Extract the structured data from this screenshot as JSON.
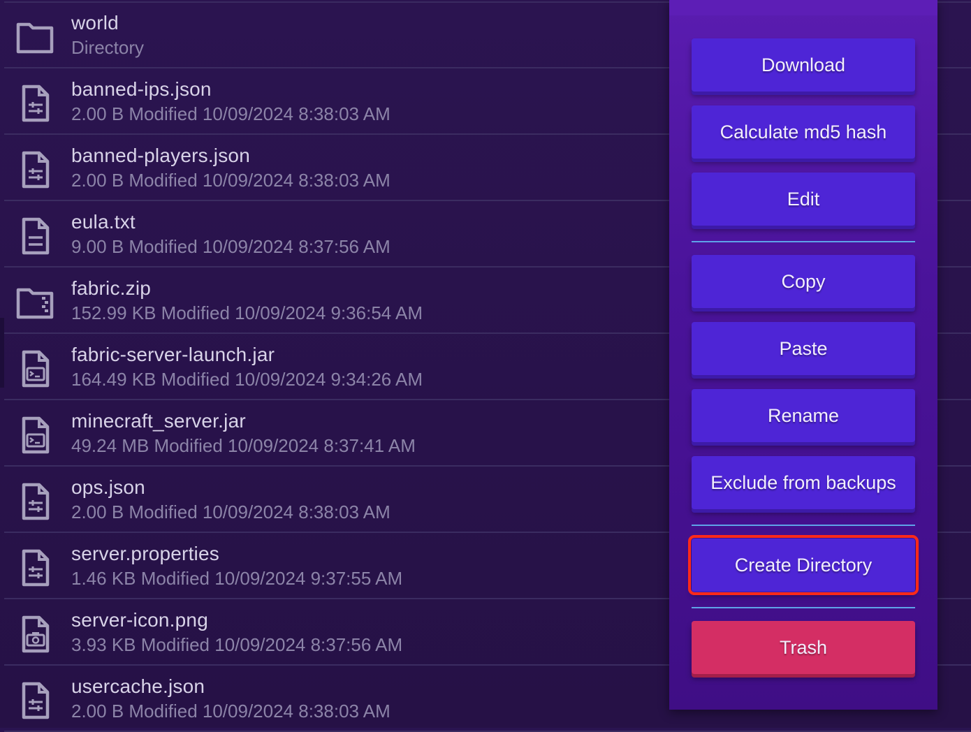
{
  "files": [
    {
      "name": "world",
      "meta": "Directory",
      "icon": "folder-icon"
    },
    {
      "name": "banned-ips.json",
      "meta": "2.00 B Modified 10/09/2024 8:38:03 AM",
      "icon": "settings-file-icon"
    },
    {
      "name": "banned-players.json",
      "meta": "2.00 B Modified 10/09/2024 8:38:03 AM",
      "icon": "settings-file-icon"
    },
    {
      "name": "eula.txt",
      "meta": "9.00 B Modified 10/09/2024 8:37:56 AM",
      "icon": "text-file-icon"
    },
    {
      "name": "fabric.zip",
      "meta": "152.99 KB Modified 10/09/2024 9:36:54 AM",
      "icon": "zip-folder-icon"
    },
    {
      "name": "fabric-server-launch.jar",
      "meta": "164.49 KB Modified 10/09/2024 9:34:26 AM",
      "icon": "terminal-file-icon"
    },
    {
      "name": "minecraft_server.jar",
      "meta": "49.24 MB Modified 10/09/2024 8:37:41 AM",
      "icon": "terminal-file-icon"
    },
    {
      "name": "ops.json",
      "meta": "2.00 B Modified 10/09/2024 8:38:03 AM",
      "icon": "settings-file-icon"
    },
    {
      "name": "server.properties",
      "meta": "1.46 KB Modified 10/09/2024 9:37:55 AM",
      "icon": "settings-file-icon"
    },
    {
      "name": "server-icon.png",
      "meta": "3.93 KB Modified 10/09/2024 8:37:56 AM",
      "icon": "image-file-icon"
    },
    {
      "name": "usercache.json",
      "meta": "2.00 B Modified 10/09/2024 8:38:03 AM",
      "icon": "settings-file-icon"
    }
  ],
  "menu": {
    "download": "Download",
    "md5": "Calculate md5 hash",
    "edit": "Edit",
    "copy": "Copy",
    "paste": "Paste",
    "rename": "Rename",
    "exclude": "Exclude from backups",
    "create_directory": "Create Directory",
    "trash": "Trash"
  },
  "colors": {
    "background": "#2a1451",
    "button": "#4e25d6",
    "trash": "#d42e64",
    "separator": "#5fa3e8",
    "highlight": "#ff2a1a"
  }
}
